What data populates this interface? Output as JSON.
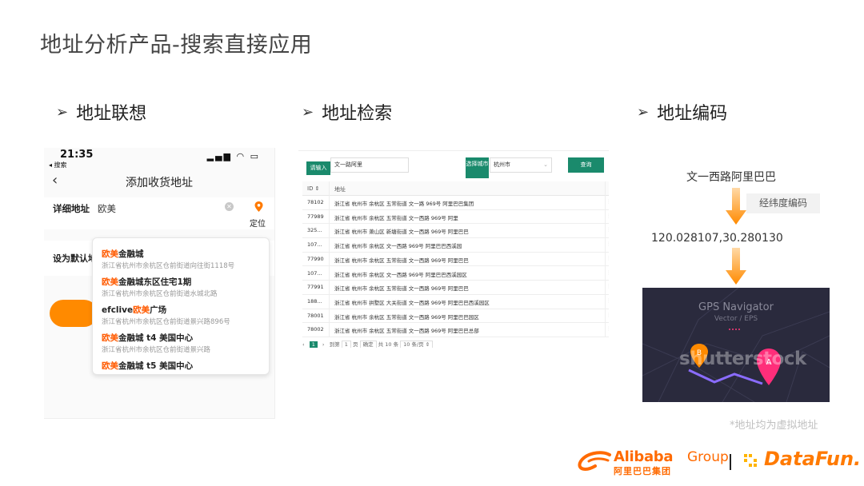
{
  "slide": {
    "title": "地址分析产品-搜索直接应用"
  },
  "sections": [
    {
      "label": "地址联想"
    },
    {
      "label": "地址检索"
    },
    {
      "label": "地址编码"
    }
  ],
  "phone": {
    "time": "21:35",
    "back_app": "◂ 搜索",
    "nav_title": "添加收货地址",
    "detail_label": "详细地址",
    "detail_value": "欧美",
    "locate_label": "定位",
    "default_label": "设为默认地",
    "suggestions": [
      {
        "highlight": "欧美",
        "name": "金融城",
        "address": "浙江省杭州市余杭区仓前街道向往街1118号"
      },
      {
        "highlight": "欧美",
        "name": "金融城东区住宅1期",
        "address": "浙江省杭州市余杭区仓前街道水城北路"
      },
      {
        "prefix": "efclive",
        "highlight": "欧美",
        "name": "广场",
        "address": "浙江省杭州市余杭区仓前街道景兴路896号"
      },
      {
        "highlight": "欧美",
        "name": "金融城 t4 美国中心",
        "address": "浙江省杭州市余杭区仓前街道景兴路"
      },
      {
        "highlight": "欧美",
        "name": "金融城 t5 美国中心",
        "address": ""
      }
    ]
  },
  "search": {
    "input_label": "请输入",
    "input_value": "文一路阿里",
    "city_label": "选择城市",
    "city_value": "杭州市",
    "query_button": "查询",
    "col_id": "ID ⇕",
    "col_addr": "地址",
    "rows": [
      {
        "id": "78102",
        "addr": "浙江省 杭州市 余杭区 五常街道 文一路 969号 阿里巴巴集团"
      },
      {
        "id": "77989",
        "addr": "浙江省 杭州市 余杭区 五常街道 文一西路 969号 阿里"
      },
      {
        "id": "325...",
        "addr": "浙江省 杭州市 萧山区 新塘街道 文一西路 969号 阿里巴巴"
      },
      {
        "id": "107...",
        "addr": "浙江省 杭州市 余杭区 文一西路 969号 阿里巴巴西溪园"
      },
      {
        "id": "77990",
        "addr": "浙江省 杭州市 余杭区 五常街道 文一西路 969号 阿里巴巴"
      },
      {
        "id": "107...",
        "addr": "浙江省 杭州市 余杭区 文一西路 969号 阿里巴巴西溪园区"
      },
      {
        "id": "77991",
        "addr": "浙江省 杭州市 余杭区 五常街道 文一西路 969号 阿里巴巴"
      },
      {
        "id": "188...",
        "addr": "浙江省 杭州市 拱墅区 大关街道 文一西路 969号 阿里巴巴西溪园区"
      },
      {
        "id": "78001",
        "addr": "浙江省 杭州市 余杭区 五常街道 文一西路 969号 阿里巴巴园区"
      },
      {
        "id": "78002",
        "addr": "浙江省 杭州市 余杭区 五常街道 文一西路 969号 阿里巴巴总部"
      }
    ],
    "more_glyph": "⋮",
    "footer": {
      "prev": "‹",
      "current_page": "1",
      "next": "›",
      "goto": "到第",
      "page_input": "1",
      "page_unit": "页",
      "confirm": "确定",
      "total": "共 10 条",
      "page_size": "10 条/页 ⇕"
    }
  },
  "geocode": {
    "address": "文一西路阿里巴巴",
    "step_label": "经纬度编码",
    "coordinates": "120.028107,30.280130",
    "image_title": "GPS Navigator",
    "image_subtitle": "Vector / EPS",
    "watermark": "shutterstock",
    "note": "*地址均为虚拟地址"
  },
  "logos": {
    "alibaba": "Alibaba",
    "group": "Group",
    "alibaba_cn": "阿里巴巴集团",
    "datafun": "DataFun."
  },
  "colors": {
    "accent_orange": "#ff8a00",
    "table_green": "#1a8a6c",
    "gps_bg": "#2a2a3d"
  }
}
